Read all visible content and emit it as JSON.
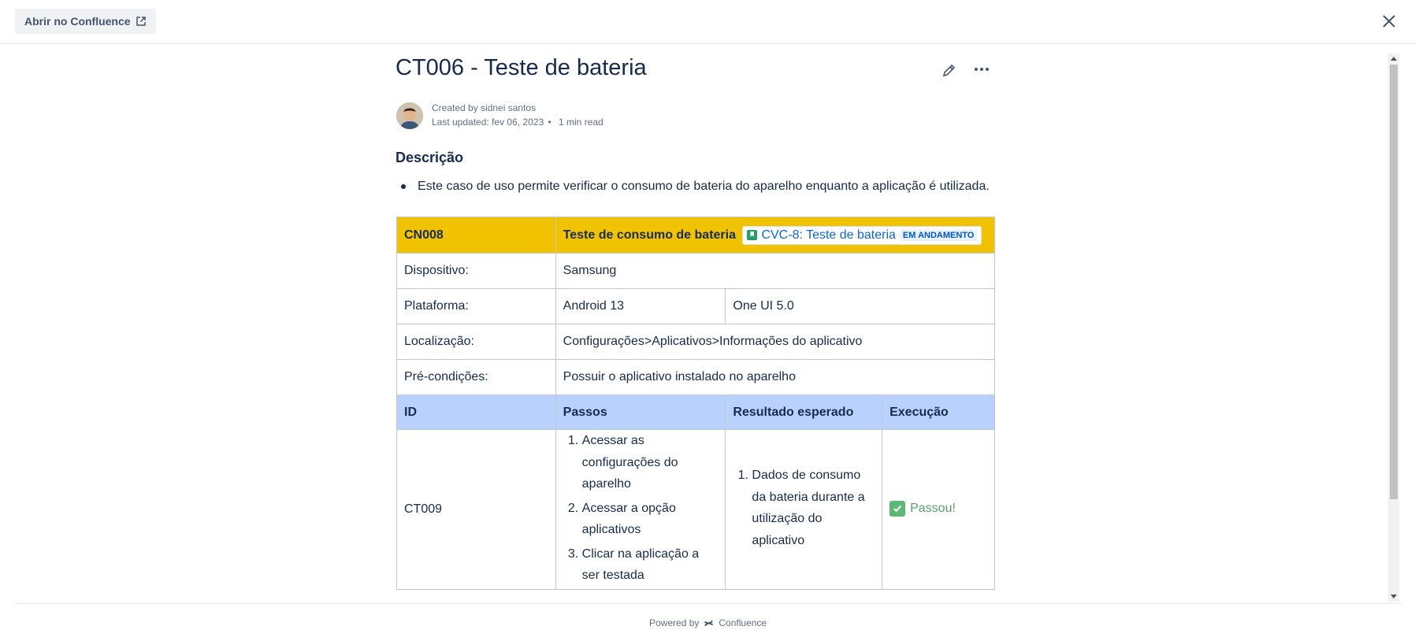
{
  "topbar": {
    "open_label": "Abrir no Confluence"
  },
  "page": {
    "title": "CT006 - Teste de bateria",
    "created_by": "Created by sidnei santos",
    "last_updated": "Last updated: fev 06, 2023",
    "read_time": "1 min read"
  },
  "description": {
    "heading": "Descrição",
    "bullet": "Este caso de uso permite verificar o consumo de bateria do aparelho enquanto a aplicação é utilizada."
  },
  "table": {
    "header": {
      "id": "CN008",
      "title": "Teste de consumo de bateria",
      "issue_link": "CVC-8: Teste de bateria",
      "issue_status": "EM ANDAMENTO"
    },
    "rows": [
      {
        "label": "Dispositivo:",
        "value": "Samsung"
      },
      {
        "label": "Plataforma:",
        "value": "Android 13",
        "value2": "One UI 5.0"
      },
      {
        "label": "Localização:",
        "value": "Configurações>Aplicativos>Informações do aplicativo"
      },
      {
        "label": "Pré-condições:",
        "value": "Possuir o aplicativo instalado no aparelho"
      }
    ],
    "columns": [
      "ID",
      "Passos",
      "Resultado esperado",
      "Execução"
    ],
    "test": {
      "id": "CT009",
      "steps": [
        "Acessar as configurações do aparelho",
        "Acessar a opção aplicativos",
        "Clicar na aplicação a ser testada"
      ],
      "expected": [
        "Dados de consumo da bateria durante a utilização do aplicativo"
      ],
      "execution": "Passou!"
    }
  },
  "footer": {
    "powered_by": "Powered by",
    "brand": "Confluence"
  },
  "colors": {
    "header_row": "#f1c200",
    "columns_row": "#b9d2fd",
    "link": "#0c66e4",
    "pass": "#5a9e6f"
  }
}
